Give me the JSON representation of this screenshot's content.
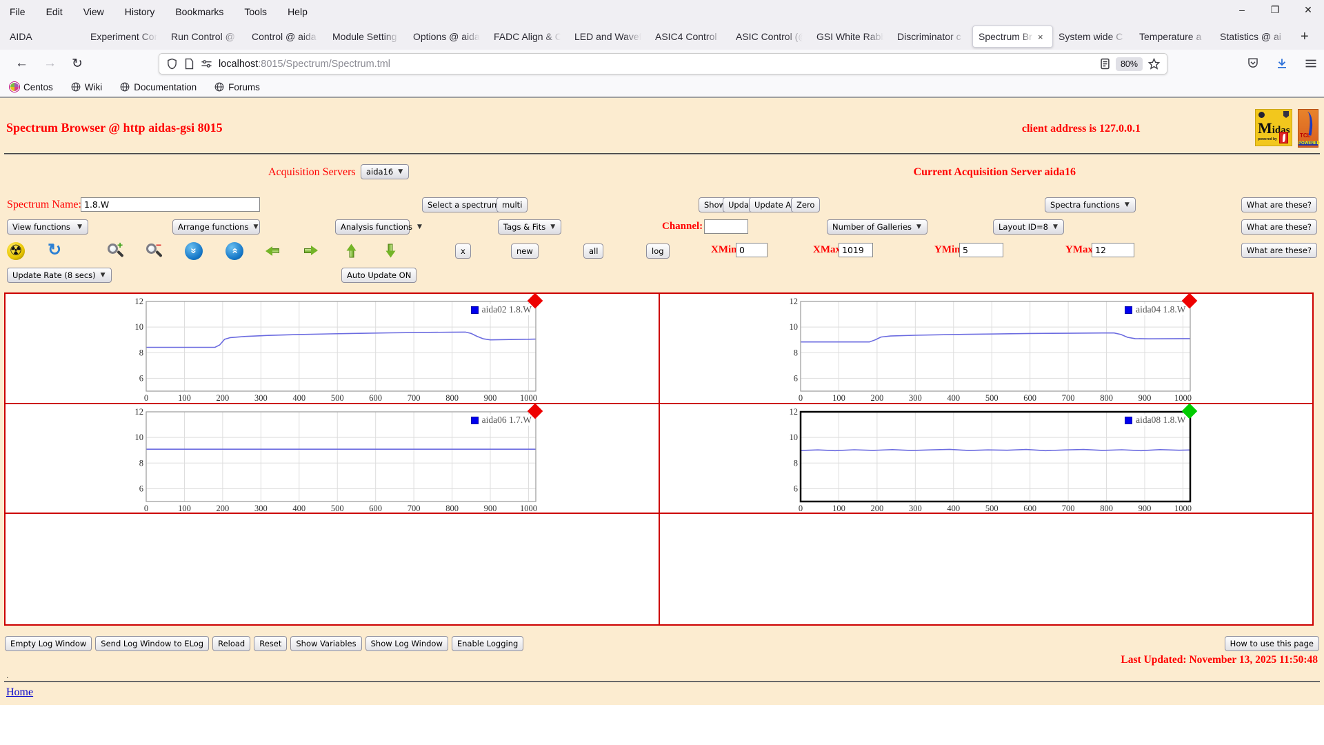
{
  "browser": {
    "menu": [
      "File",
      "Edit",
      "View",
      "History",
      "Bookmarks",
      "Tools",
      "Help"
    ],
    "window_controls": [
      "–",
      "❐",
      "✕"
    ],
    "tabs": [
      {
        "label": "AIDA",
        "active": false
      },
      {
        "label": "Experiment Con",
        "active": false
      },
      {
        "label": "Run Control @",
        "active": false
      },
      {
        "label": "Control @ aida",
        "active": false
      },
      {
        "label": "Module Setting",
        "active": false
      },
      {
        "label": "Options @ aida",
        "active": false
      },
      {
        "label": "FADC Align & C",
        "active": false
      },
      {
        "label": "LED and Wavef",
        "active": false
      },
      {
        "label": "ASIC4 Control",
        "active": false
      },
      {
        "label": "ASIC Control (@",
        "active": false
      },
      {
        "label": "GSI White Rabb",
        "active": false
      },
      {
        "label": "Discriminator c",
        "active": false
      },
      {
        "label": "Spectrum Br",
        "active": true
      },
      {
        "label": "System wide C",
        "active": false
      },
      {
        "label": "Temperature a",
        "active": false
      },
      {
        "label": "Statistics @ ai",
        "active": false
      }
    ],
    "new_tab_label": "+",
    "tab_close_label": "×",
    "back": "←",
    "forward": "→",
    "reload": "↻",
    "url_host": "localhost",
    "url_path": ":8015/Spectrum/Spectrum.tml",
    "zoom_level": "80%",
    "bookmarks": [
      {
        "label": "Centos",
        "icon": "centos"
      },
      {
        "label": "Wiki",
        "icon": "globe"
      },
      {
        "label": "Documentation",
        "icon": "globe"
      },
      {
        "label": "Forums",
        "icon": "globe"
      }
    ]
  },
  "page": {
    "title": "Spectrum Browser @ http aidas-gsi 8015",
    "client_address": "client address is 127.0.0.1",
    "acquisition_label": "Acquisition Servers",
    "acquisition_value": "aida16",
    "current_server": "Current Acquisition Server aida16",
    "spectrum_name_label": "Spectrum Name:",
    "spectrum_name_value": "1.8.W",
    "select_spectrum": "Select a spectrum",
    "multi": "multi",
    "show": "Show",
    "update": "Update",
    "update_all": "Update All",
    "zero": "Zero",
    "spectra_functions": "Spectra functions",
    "what_are_these": "What are these?",
    "view_functions": "View functions",
    "arrange_functions": "Arrange functions",
    "analysis_functions": "Analysis functions",
    "tags_fits": "Tags & Fits",
    "channel_label": "Channel:",
    "channel_value": "",
    "number_of_galleries": "Number of Galleries",
    "layout_id": "Layout ID=8",
    "x_button": "x",
    "new_button": "new",
    "all_button": "all",
    "log_button": "log",
    "xmin_label": "XMin",
    "xmin_value": "0",
    "xmax_label": "XMax",
    "xmax_value": "1019",
    "ymin_label": "YMin",
    "ymin_value": "5",
    "ymax_label": "YMax",
    "ymax_value": "12",
    "toolbar_icons": [
      "radioactive",
      "refresh",
      "zoom-in",
      "zoom-out",
      "scroll-down",
      "scroll-up",
      "arrow-left",
      "arrow-right",
      "arrow-up",
      "arrow-down"
    ],
    "update_rate": "Update Rate (8 secs)",
    "auto_update": "Auto Update ON",
    "footer_buttons": [
      "Empty Log Window",
      "Send Log Window to ELog",
      "Reload",
      "Reset",
      "Show Variables",
      "Show Log Window",
      "Enable Logging"
    ],
    "how_to": "How to use this page",
    "last_updated": "Last Updated: November 13, 2025 11:50:48",
    "dot": ".",
    "home": "Home",
    "logos": {
      "midas_big": "M",
      "midas_rest": "idas",
      "midas_sub": "powered by",
      "tcl_line1": "TCL",
      "tcl_line2": "POWERED"
    }
  },
  "colors": {
    "page_bg": "#fcecd0",
    "accent_red": "#ff0000",
    "table_border": "#cc0000",
    "line_color": "#6b6be0",
    "legend_square": "#0000ee",
    "marker_red": "#ee0000",
    "marker_green": "#00cc00"
  },
  "chart_data": {
    "type": "line",
    "axes": {
      "xlim": [
        0,
        1019
      ],
      "ylim": [
        5,
        12
      ],
      "xticks": [
        0,
        100,
        200,
        300,
        400,
        500,
        600,
        700,
        800,
        900,
        1000
      ],
      "yticks": [
        6,
        8,
        10,
        12
      ],
      "grid": true,
      "legend_position": "top-right"
    },
    "charts": [
      {
        "legend": "aida02 1.8.W",
        "marker_color": "#ee0000",
        "selected": false,
        "points": [
          [
            0,
            8.42
          ],
          [
            90,
            8.42
          ],
          [
            180,
            8.42
          ],
          [
            192,
            8.6
          ],
          [
            205,
            9.05
          ],
          [
            220,
            9.18
          ],
          [
            260,
            9.27
          ],
          [
            320,
            9.35
          ],
          [
            400,
            9.42
          ],
          [
            480,
            9.47
          ],
          [
            560,
            9.51
          ],
          [
            640,
            9.55
          ],
          [
            720,
            9.58
          ],
          [
            800,
            9.6
          ],
          [
            835,
            9.61
          ],
          [
            850,
            9.5
          ],
          [
            865,
            9.28
          ],
          [
            882,
            9.08
          ],
          [
            900,
            9.0
          ],
          [
            940,
            9.02
          ],
          [
            1000,
            9.05
          ],
          [
            1019,
            9.06
          ]
        ]
      },
      {
        "legend": "aida04 1.8.W",
        "marker_color": "#ee0000",
        "selected": false,
        "points": [
          [
            0,
            8.84
          ],
          [
            90,
            8.84
          ],
          [
            180,
            8.84
          ],
          [
            195,
            9.0
          ],
          [
            210,
            9.22
          ],
          [
            235,
            9.3
          ],
          [
            300,
            9.36
          ],
          [
            400,
            9.42
          ],
          [
            500,
            9.46
          ],
          [
            600,
            9.5
          ],
          [
            700,
            9.52
          ],
          [
            790,
            9.54
          ],
          [
            820,
            9.54
          ],
          [
            838,
            9.42
          ],
          [
            855,
            9.2
          ],
          [
            875,
            9.1
          ],
          [
            910,
            9.08
          ],
          [
            1000,
            9.1
          ],
          [
            1019,
            9.1
          ]
        ]
      },
      {
        "legend": "aida06 1.7.W",
        "marker_color": "#ee0000",
        "selected": false,
        "points": [
          [
            0,
            9.08
          ],
          [
            200,
            9.08
          ],
          [
            400,
            9.08
          ],
          [
            600,
            9.08
          ],
          [
            800,
            9.08
          ],
          [
            1019,
            9.08
          ]
        ]
      },
      {
        "legend": "aida08 1.8.W",
        "marker_color": "#00cc00",
        "selected": true,
        "points": [
          [
            0,
            8.98
          ],
          [
            45,
            9.03
          ],
          [
            90,
            8.97
          ],
          [
            140,
            9.04
          ],
          [
            190,
            8.99
          ],
          [
            240,
            9.05
          ],
          [
            290,
            8.98
          ],
          [
            340,
            9.03
          ],
          [
            390,
            9.07
          ],
          [
            440,
            8.98
          ],
          [
            490,
            9.03
          ],
          [
            540,
            9.0
          ],
          [
            590,
            9.06
          ],
          [
            640,
            8.97
          ],
          [
            690,
            9.02
          ],
          [
            740,
            9.06
          ],
          [
            790,
            8.99
          ],
          [
            840,
            9.04
          ],
          [
            890,
            8.97
          ],
          [
            940,
            9.05
          ],
          [
            990,
            9.0
          ],
          [
            1019,
            9.02
          ]
        ]
      }
    ]
  }
}
